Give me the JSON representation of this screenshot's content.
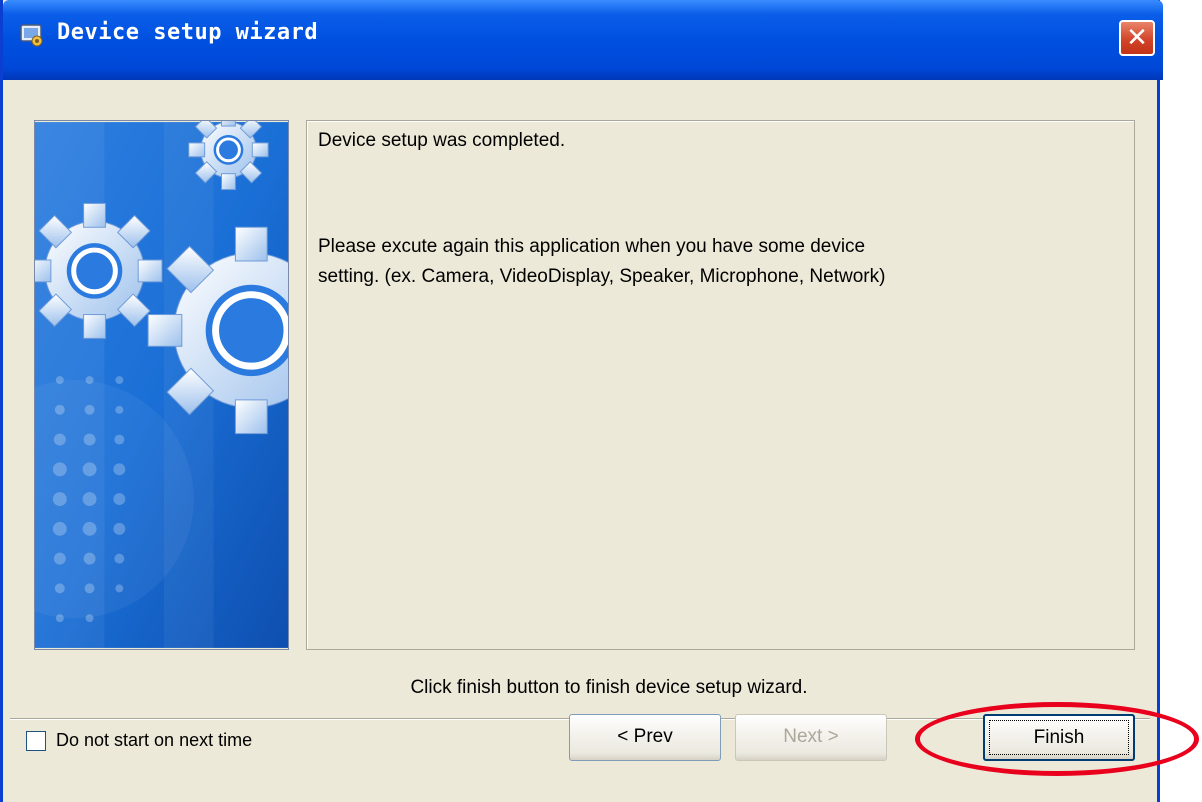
{
  "window": {
    "title": "Device setup wizard",
    "close_symbol": "✕"
  },
  "message": {
    "line1": "Device setup was completed.",
    "line2": "Please excute again this application when you have some device",
    "line3": "setting. (ex. Camera, VideoDisplay, Speaker, Microphone, Network)"
  },
  "footer": {
    "instruction": "Click finish button to finish device setup wizard."
  },
  "controls": {
    "checkbox_label": "Do not start on next time",
    "checkbox_checked": false,
    "prev_label": "< Prev",
    "next_label": "Next >",
    "next_enabled": false,
    "finish_label": "Finish"
  },
  "colors": {
    "titlebar": "#0050e0",
    "highlight": "#e8001c",
    "banner_blue": "#1a6fd6"
  },
  "icons": {
    "app_icon": "device-wizard-icon",
    "close": "close-icon",
    "banner": "gears-illustration"
  }
}
